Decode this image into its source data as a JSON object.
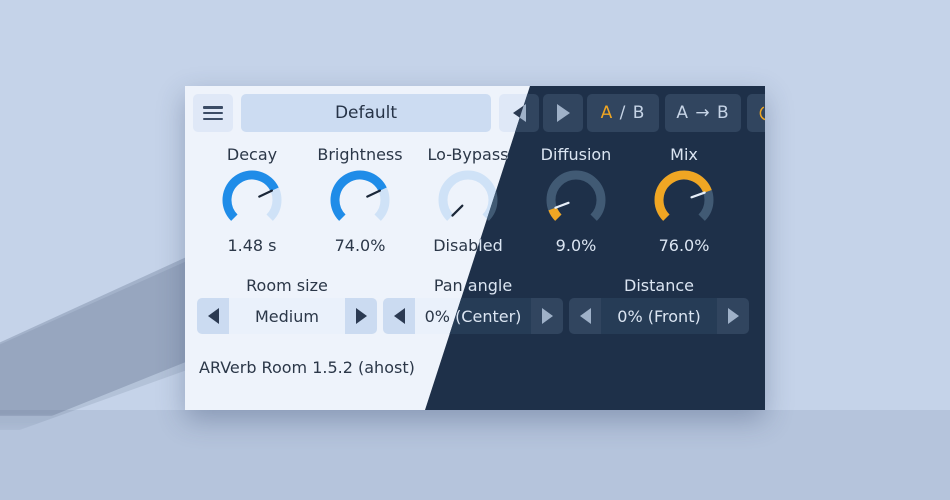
{
  "window": {
    "background_color": "#c5d3e9",
    "panel_light_bg": "#eef3fb",
    "panel_dark_bg": "#1e3049",
    "accent_light": "#1f8ce8",
    "accent_dark": "#f0a623"
  },
  "toolbar": {
    "menu_icon": "hamburger-menu-icon",
    "preset_value": "Default",
    "preset_placeholder": "Default",
    "prev_icon": "triangle-left-icon",
    "next_icon": "triangle-right-icon",
    "ab_label_a": "A",
    "ab_label_rest": " / B",
    "a_to_b_label": "A → B",
    "power_icon": "power-icon",
    "power_glyph": "⏻"
  },
  "knobs": [
    {
      "label": "Decay",
      "value": "1.48 s",
      "percent": 74
    },
    {
      "label": "Brightness",
      "value": "74.0%",
      "percent": 74
    },
    {
      "label": "Lo-Bypass",
      "value": "Disabled",
      "percent": 0
    },
    {
      "label": "Diffusion",
      "value": "9.0%",
      "percent": 9
    },
    {
      "label": "Mix",
      "value": "76.0%",
      "percent": 76
    }
  ],
  "selectors": [
    {
      "label": "Room size",
      "value": "Medium",
      "prev_icon": "triangle-left-icon",
      "next_icon": "triangle-right-icon"
    },
    {
      "label": "Pan angle",
      "value": "0% (Center)",
      "prev_icon": "triangle-left-icon",
      "next_icon": "triangle-right-icon"
    },
    {
      "label": "Distance",
      "value": "0% (Front)",
      "prev_icon": "triangle-left-icon",
      "next_icon": "triangle-right-icon"
    }
  ],
  "footer": {
    "text": "ARVerb Room 1.5.2 (ahost)"
  }
}
